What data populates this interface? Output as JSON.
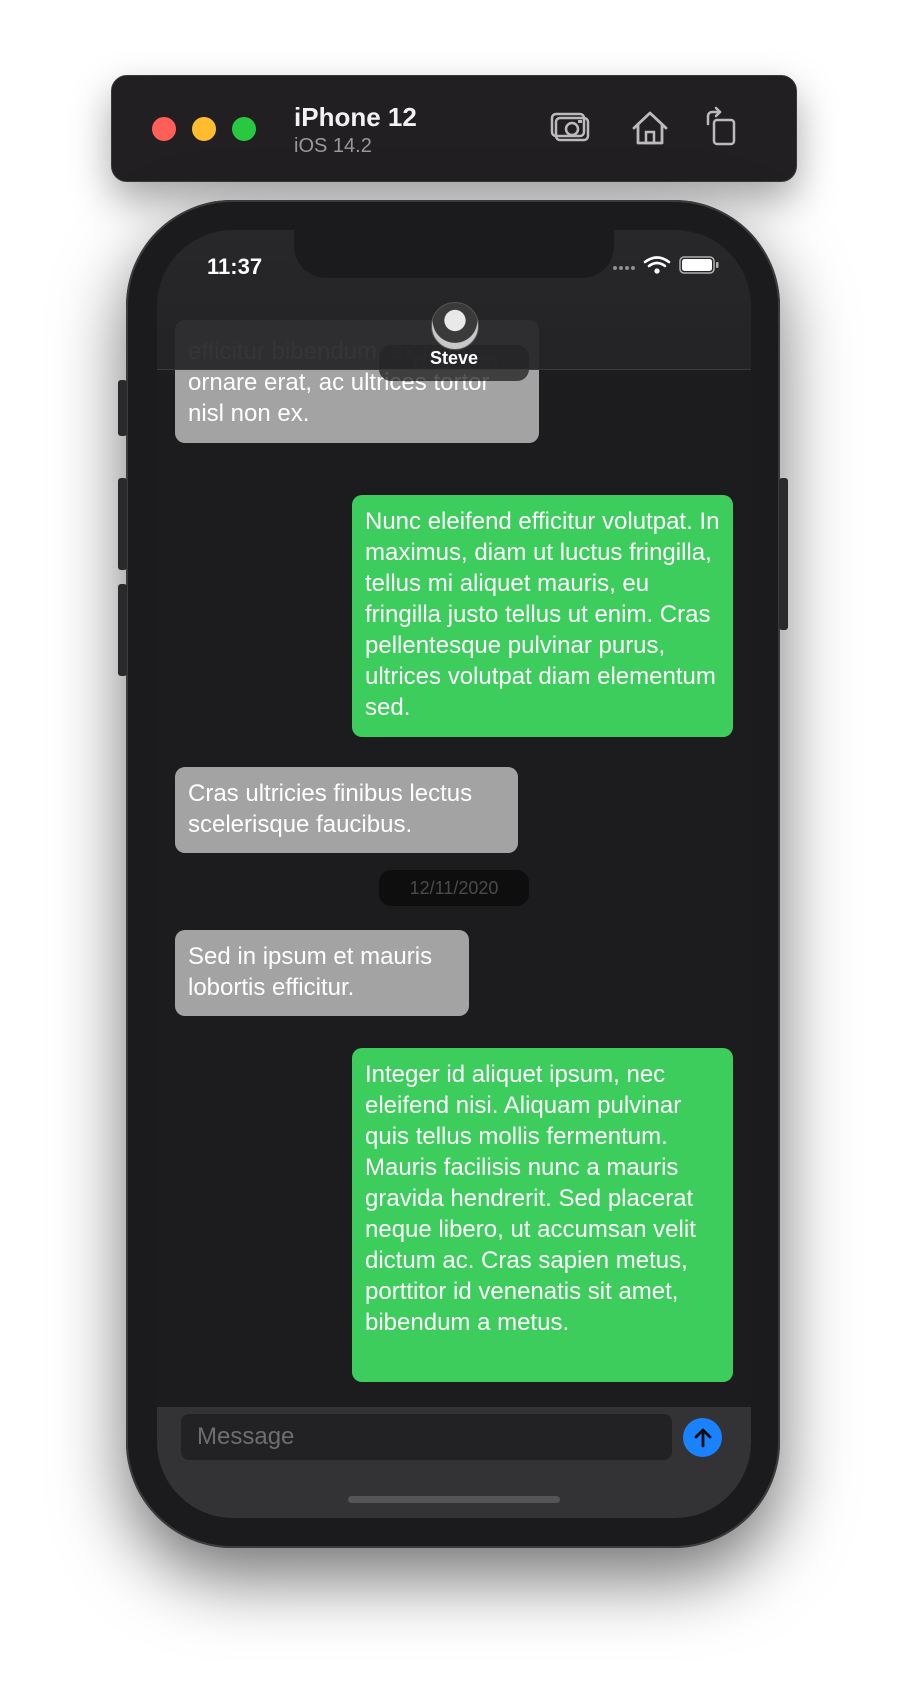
{
  "simulator": {
    "device_name": "iPhone 12",
    "os_version": "iOS 14.2",
    "icons": [
      "screenshot-icon",
      "home-icon",
      "rotate-icon"
    ]
  },
  "status_bar": {
    "time": "11:37"
  },
  "header": {
    "contact_name": "Steve",
    "avatar": "contact-avatar"
  },
  "messages": [
    {
      "direction": "in",
      "text": "efficitur bibendum, ex risus ornare erat, ac ultrices tortor nisl non ex."
    },
    {
      "direction": "out",
      "text": "Nunc eleifend efficitur volutpat. In maximus, diam ut luctus fringilla, tellus mi aliquet mauris, eu fringilla justo tellus ut enim. Cras pellentesque pulvinar purus, ultrices volutpat diam elementum sed."
    },
    {
      "direction": "in",
      "text": "Cras ultricies finibus lectus scelerisque faucibus."
    },
    {
      "direction": "in",
      "text": "Sed in ipsum et mauris lobortis efficitur."
    },
    {
      "direction": "out",
      "text": "Integer id aliquet ipsum, nec eleifend nisi. Aliquam pulvinar quis tellus mollis fermentum. Mauris facilisis nunc a mauris gravida hendrerit. Sed placerat neque libero, ut accumsan velit dictum ac. Cras sapien metus, porttitor id venenatis sit amet, bibendum a metus."
    }
  ],
  "date_separators": [
    "11/11/2020",
    "12/11/2020"
  ],
  "composer": {
    "placeholder": "Message",
    "value": ""
  },
  "colors": {
    "incoming_bubble": "#a3a3a3",
    "outgoing_bubble": "#3dcd5c",
    "send_button": "#1a82ff",
    "background": "#1c1c1e"
  }
}
